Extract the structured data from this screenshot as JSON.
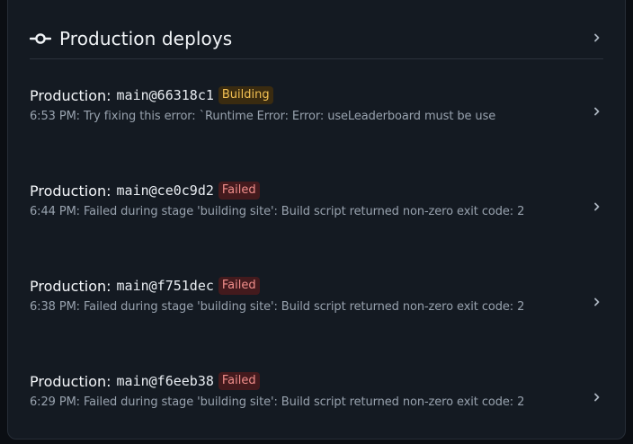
{
  "header": {
    "title": "Production deploys",
    "icon": "commit-icon",
    "chevron": "chevron-right-icon"
  },
  "colors": {
    "background": "#141a22",
    "building_badge_bg": "#3a2b10",
    "building_badge_text": "#f2c053",
    "failed_badge_bg": "#431a1d",
    "failed_badge_text": "#f08d8b"
  },
  "deploys": [
    {
      "env": "Production:",
      "ref": "main@66318c1",
      "status": "Building",
      "message": "6:53 PM: Try fixing this error: `Runtime Error: Error: useLeaderboard must be use"
    },
    {
      "env": "Production:",
      "ref": "main@ce0c9d2",
      "status": "Failed",
      "message": "6:44 PM: Failed during stage 'building site': Build script returned non-zero exit code: 2"
    },
    {
      "env": "Production:",
      "ref": "main@f751dec",
      "status": "Failed",
      "message": "6:38 PM: Failed during stage 'building site': Build script returned non-zero exit code: 2"
    },
    {
      "env": "Production:",
      "ref": "main@f6eeb38",
      "status": "Failed",
      "message": "6:29 PM: Failed during stage 'building site': Build script returned non-zero exit code: 2"
    }
  ]
}
